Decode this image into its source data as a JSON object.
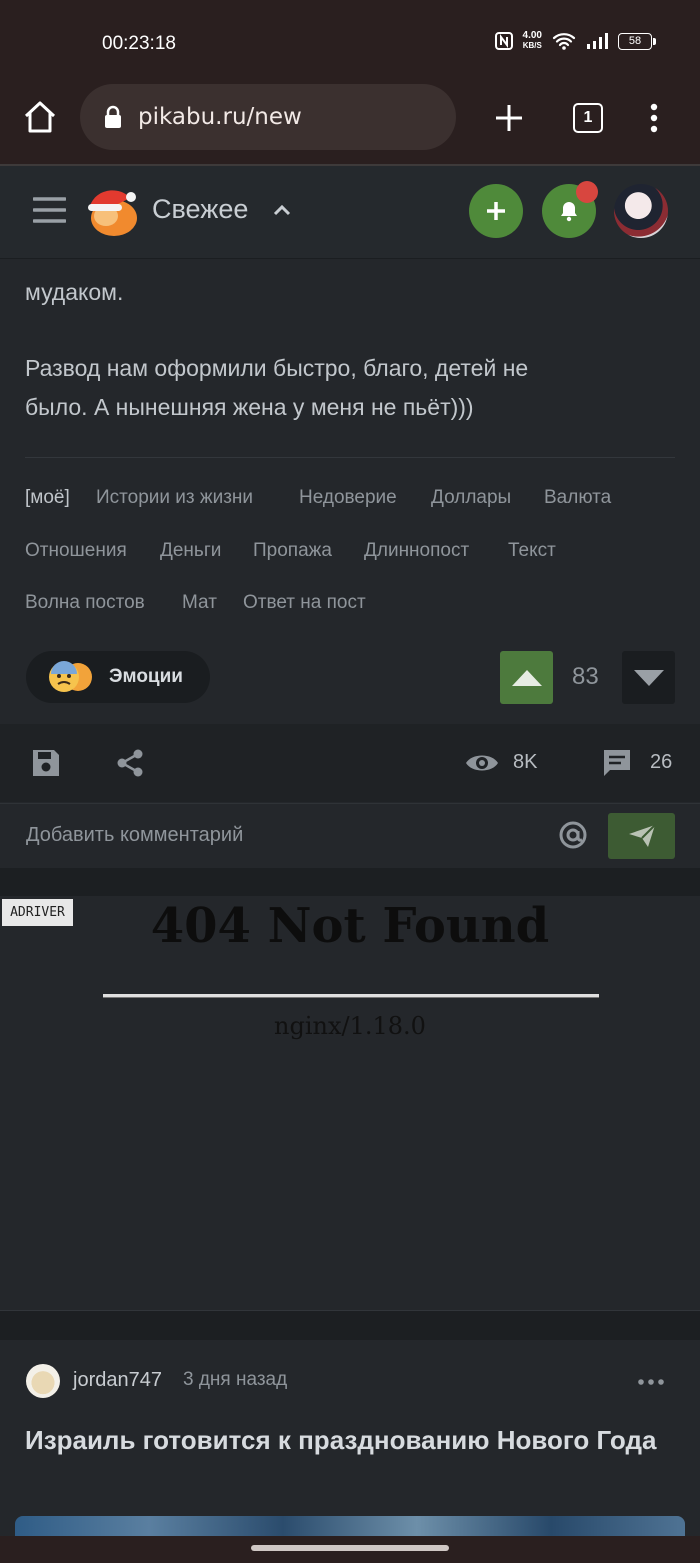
{
  "status_bar": {
    "time": "00:23:18",
    "net_speed_value": "4.00",
    "net_speed_unit": "KB/S",
    "battery": "58"
  },
  "browser": {
    "url": "pikabu.ru/new",
    "tab_count": "1"
  },
  "header": {
    "title": "Свежее"
  },
  "post": {
    "text_lines": [
      "мудаком.",
      "Развод нам оформили быстро, благо, детей не",
      "было. А нынешняя жена у меня не пьёт)))"
    ],
    "tags": [
      "[моё]",
      "Истории из жизни",
      "Недоверие",
      "Доллары",
      "Валюта",
      "Отношения",
      "Деньги",
      "Пропажа",
      "Длиннопост",
      "Текст",
      "Волна постов",
      "Мат",
      "Ответ на пост"
    ],
    "emotions_label": "Эмоции",
    "rating": "83",
    "views": "8K",
    "comments": "26",
    "comment_placeholder": "Добавить комментарий"
  },
  "ad": {
    "badge": "ADRIVER",
    "title": "404 Not Found",
    "footer": "nginx/1.18.0"
  },
  "next_post": {
    "author": "jordan747",
    "time": "3 дня назад",
    "title": "Израиль готовится к празднованию Нового Года"
  },
  "colors": {
    "accent_green": "#4f8a3a",
    "notif_red": "#d8463f",
    "background": "#24272b"
  }
}
